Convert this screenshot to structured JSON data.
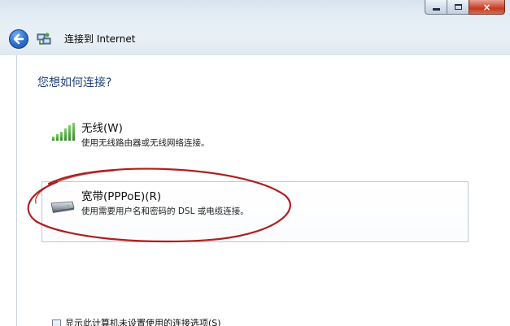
{
  "window": {
    "title": "连接到 Internet",
    "caption_minimize": "",
    "caption_maximize": "",
    "caption_close": "×"
  },
  "content": {
    "heading": "您想如何连接?"
  },
  "options": [
    {
      "title": "无线(W)",
      "description": "使用无线路由器或无线网络连接。",
      "icon": "wireless-signal-icon"
    },
    {
      "title": "宽带(PPPoE)(R)",
      "description": "使用需要用户名和密码的 DSL 或电缆连接。",
      "icon": "broadband-modem-icon"
    }
  ],
  "footer": {
    "checkbox_label": "显示此计算机未设置使用的连接选项(S)"
  },
  "colors": {
    "heading": "#1f3f7a",
    "annotation_circle": "#b01e1e",
    "selection_border": "#b9c8d8"
  }
}
